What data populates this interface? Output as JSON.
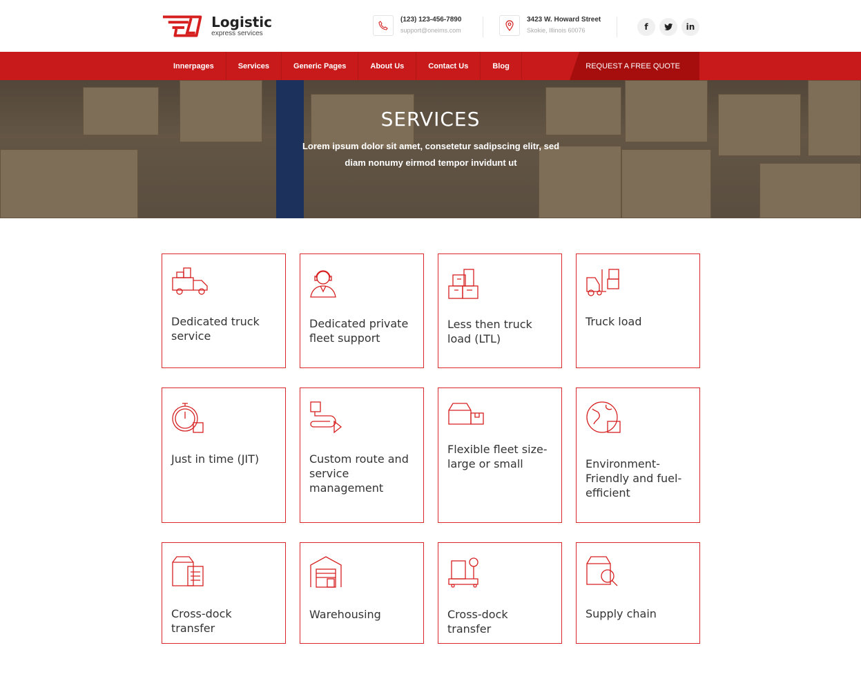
{
  "header": {
    "logo_title": "Logistic",
    "logo_subtitle": "express services",
    "phone": "(123) 123-456-7890",
    "email": "support@oneims.com",
    "address_line1": "3423 W. Howard Street",
    "address_line2": "Skokie, Illinois 60076",
    "social": [
      {
        "icon": "facebook-icon",
        "glyph": "f"
      },
      {
        "icon": "twitter-icon",
        "glyph": "t"
      },
      {
        "icon": "linkedin-icon",
        "glyph": "in"
      }
    ]
  },
  "nav": {
    "items": [
      "Innerpages",
      "Services",
      "Generic Pages",
      "About Us",
      "Contact Us",
      "Blog"
    ],
    "quote_button": "REQUEST A FREE QUOTE"
  },
  "hero": {
    "title": "SERVICES",
    "subtitle": "Lorem ipsum dolor sit amet, consetetur sadipscing elitr, sed diam nonumy eirmod tempor invidunt ut"
  },
  "services": [
    {
      "label": "Dedicated truck service",
      "icon": "truck-boxes-icon"
    },
    {
      "label": "Dedicated private fleet support",
      "icon": "support-agent-icon"
    },
    {
      "label": "Less then truck load (LTL)",
      "icon": "stacked-boxes-icon"
    },
    {
      "label": "Truck load",
      "icon": "forklift-icon"
    },
    {
      "label": "Just in time (JIT)",
      "icon": "stopwatch-box-icon"
    },
    {
      "label": "Custom route and service management",
      "icon": "route-icon"
    },
    {
      "label": "Flexible fleet size- large or small",
      "icon": "boxes-icon"
    },
    {
      "label": "Environment-Friendly and fuel-efficient",
      "icon": "globe-box-icon"
    },
    {
      "label": "Cross-dock transfer",
      "icon": "box-clipboard-icon"
    },
    {
      "label": "Warehousing",
      "icon": "warehouse-icon"
    },
    {
      "label": "Cross-dock transfer",
      "icon": "scale-box-icon"
    },
    {
      "label": "Supply chain",
      "icon": "box-search-icon"
    }
  ],
  "colors": {
    "accent": "#c81a1a",
    "card_border": "#d9262a"
  }
}
